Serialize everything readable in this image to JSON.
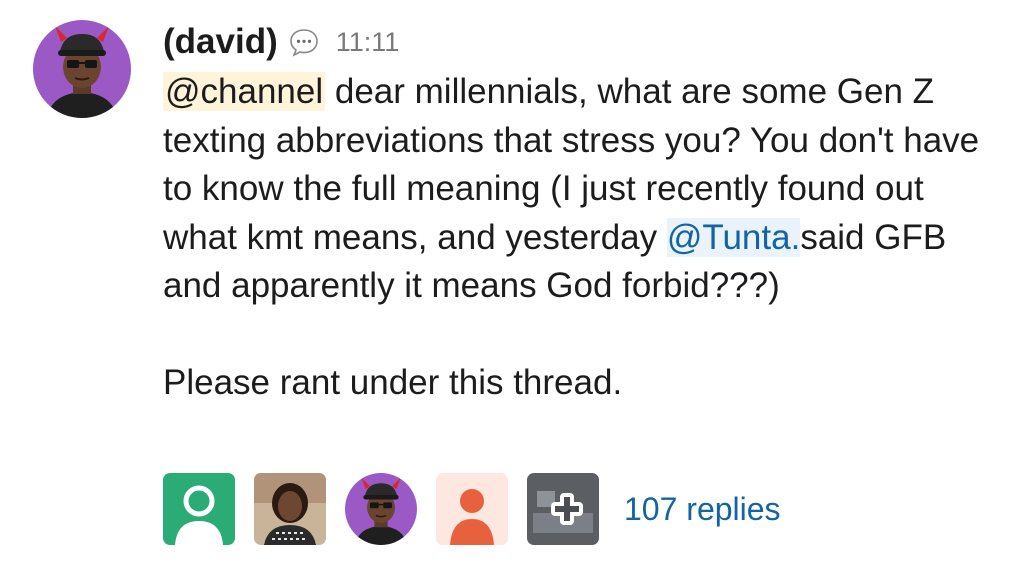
{
  "message": {
    "author": "(david)",
    "timestamp": "11:11",
    "avatar_icon": "devil-emoji-avatar-icon",
    "mention_channel": "@channel",
    "text_part1": " dear millennials, what are some Gen Z texting abbreviations that stress you? You don't have to know the full meaning (I just recently found out what kmt means, and yesterday ",
    "mention_user": "@Tunta.",
    "text_part2": "said GFB and apparently it means God forbid???)",
    "text_part3": "Please rant under this thread."
  },
  "thread": {
    "reply_count_label": "107 replies",
    "participants": [
      {
        "icon": "default-user-green-icon",
        "color": "#2bac76"
      },
      {
        "icon": "photo-avatar-woman"
      },
      {
        "icon": "devil-emoji-avatar-icon"
      },
      {
        "icon": "default-user-orange-icon",
        "color": "#e8613f"
      },
      {
        "icon": "more-participants-plus-icon"
      }
    ]
  },
  "colors": {
    "mention_channel_bg": "#fdf4da",
    "mention_user": "#1264a3",
    "avatar_bg": "#9b59c6"
  }
}
